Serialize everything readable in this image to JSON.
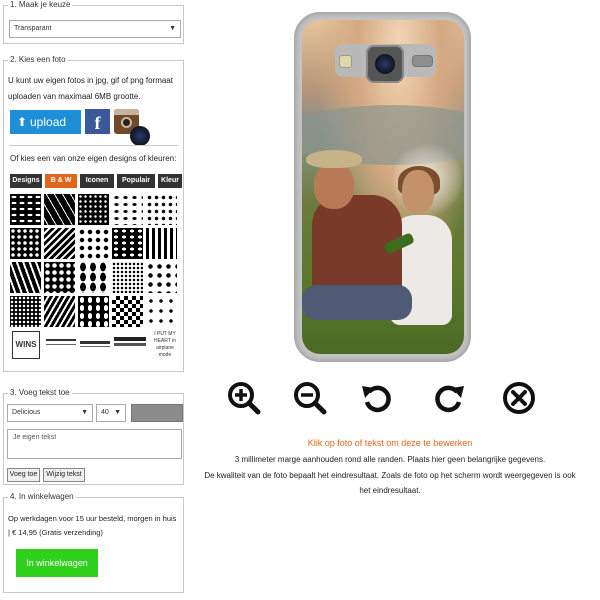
{
  "step1": {
    "legend": "1. Maak je keuze",
    "select_value": "Transparant"
  },
  "step2": {
    "legend": "2. Kies een foto",
    "description": "U kunt uw eigen fotos in jpg, gif of png formaat uploaden van maximaal 6MB grootte.",
    "upload_label": "upload",
    "facebook_letter": "f",
    "or_text": "Of kies een van onze eigen designs of kleuren:",
    "tabs": [
      "Designs",
      "B & W",
      "Iconen",
      "Populair",
      "Kleur"
    ],
    "active_tab": "B & W",
    "minis": [
      "WINS",
      "",
      "",
      "",
      "I PUT MY HEART in airplane mode"
    ]
  },
  "step3": {
    "legend": "3. Voeg tekst toe",
    "font_value": "Delicious",
    "size_value": "40",
    "textarea_placeholder": "Je eigen tekst",
    "add_text_label": "Voeg toe",
    "edit_text_label": "Wijzig tekst"
  },
  "step4": {
    "legend": "4. In winkelwagen",
    "description": "Op werkdagen voor 15 uur besteld, morgen in huis | € 14,95 (Gratis verzending)",
    "cart_label": "In winkelwagen"
  },
  "tools": [
    "zoom-in-icon",
    "zoom-out-icon",
    "rotate-left-icon",
    "rotate-right-icon",
    "remove-icon"
  ],
  "hints": {
    "click_to_edit": "Klik op foto of tekst om deze te bewerken",
    "margin_note": "3 millimeter marge aanhouden rond alle randen. Plaats hier geen belangrijke gegevens.",
    "quality_note_1": "De kwaliteit van de foto bepaalt het eindresultaat. Zoals de foto op het scherm wordt weergegeven is ook",
    "quality_note_2": "het eindresultaat."
  },
  "colors": {
    "orange": "#e0651d",
    "upload_blue": "#1e8fd6",
    "cart_green": "#2fcf1c",
    "tab_dark": "#333333"
  }
}
